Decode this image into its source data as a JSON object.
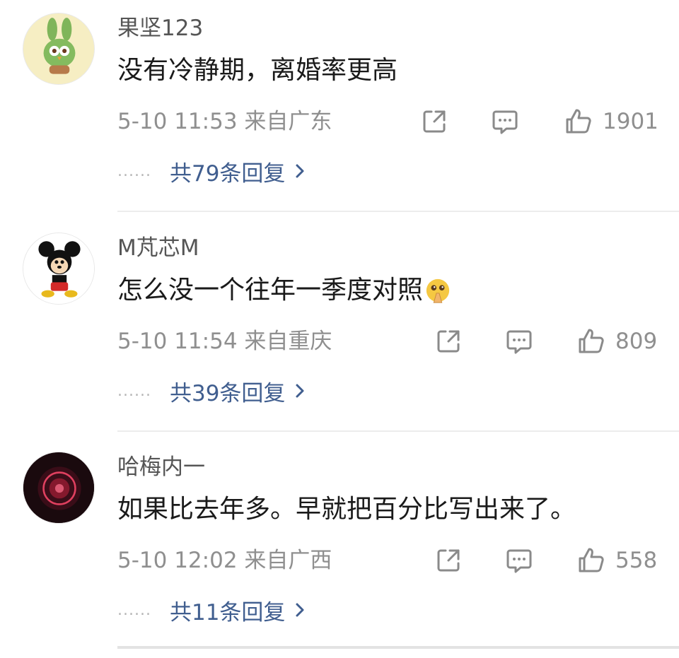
{
  "comments": [
    {
      "username": "果坚123",
      "text": "没有冷静期，离婚率更高",
      "meta": "5-10 11:53 来自广东",
      "likes": "1901",
      "reply_dots": "......",
      "replies": "共79条回复",
      "avatar_icon": "green-bunny-avatar",
      "share_icon": "share-icon",
      "comment_icon": "comment-icon",
      "like_icon": "thumbs-up-icon"
    },
    {
      "username": "M芃芯M",
      "text": "怎么没一个往年一季度对照",
      "meta": "5-10 11:54 来自重庆",
      "likes": "809",
      "reply_dots": "......",
      "replies": "共39条回复",
      "avatar_icon": "mickey-mouse-avatar",
      "emoji": "pleading-hands-emoji",
      "share_icon": "share-icon",
      "comment_icon": "comment-icon",
      "like_icon": "thumbs-up-icon"
    },
    {
      "username": "哈梅内一",
      "text": "如果比去年多。早就把百分比写出来了。",
      "meta": "5-10 12:02 来自广西",
      "likes": "558",
      "reply_dots": "......",
      "replies": "共11条回复",
      "avatar_icon": "neon-sign-avatar",
      "share_icon": "share-icon",
      "comment_icon": "comment-icon",
      "like_icon": "thumbs-up-icon"
    }
  ],
  "colors": {
    "link": "#405e8f",
    "meta": "#8f8f8f",
    "text": "#1a1a1a"
  }
}
